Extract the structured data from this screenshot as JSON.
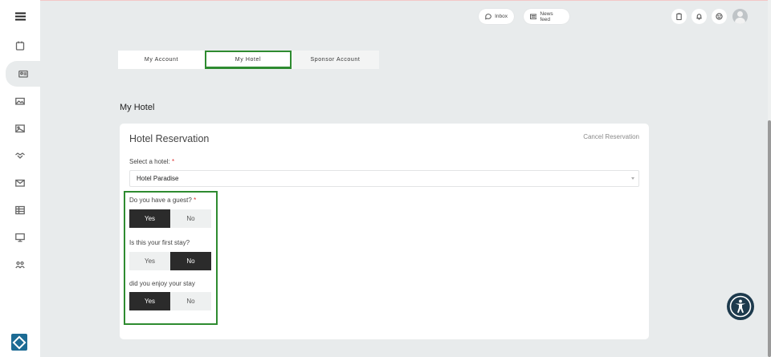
{
  "topbar": {
    "inbox_label": "Inbox",
    "newsfeed_label": "News feed",
    "icons": [
      "clipboard-icon",
      "bell-icon",
      "smiley-icon"
    ]
  },
  "sidebar": {
    "items": [
      "calendar-icon",
      "id-card-icon",
      "image-icon",
      "photo-icon",
      "handshake-icon",
      "mail-icon",
      "table-icon",
      "monitor-icon",
      "group-icon"
    ],
    "active_index": 1
  },
  "tabs": [
    {
      "label": "My Account"
    },
    {
      "label": "My Hotel"
    },
    {
      "label": "Sponsor Account"
    }
  ],
  "page": {
    "section_title": "My Hotel"
  },
  "card": {
    "title": "Hotel Reservation",
    "cancel_label": "Cancel Reservation",
    "hotel_label": "Select a hotel:",
    "required_mark": "*",
    "hotel_value": "Hotel Paradise",
    "questions": [
      {
        "label": "Do you have a guest?",
        "required": true,
        "yes": "Yes",
        "no": "No",
        "selected": "Yes"
      },
      {
        "label": "Is this your first stay?",
        "required": false,
        "yes": "Yes",
        "no": "No",
        "selected": "No"
      },
      {
        "label": "did you enjoy your stay",
        "required": false,
        "yes": "Yes",
        "no": "No",
        "selected": "Yes"
      }
    ]
  },
  "colors": {
    "background": "#e8ebec",
    "highlight": "#2e8b30",
    "toggle_on": "#2b2b2b",
    "accessibility": "#1d3a4d"
  }
}
